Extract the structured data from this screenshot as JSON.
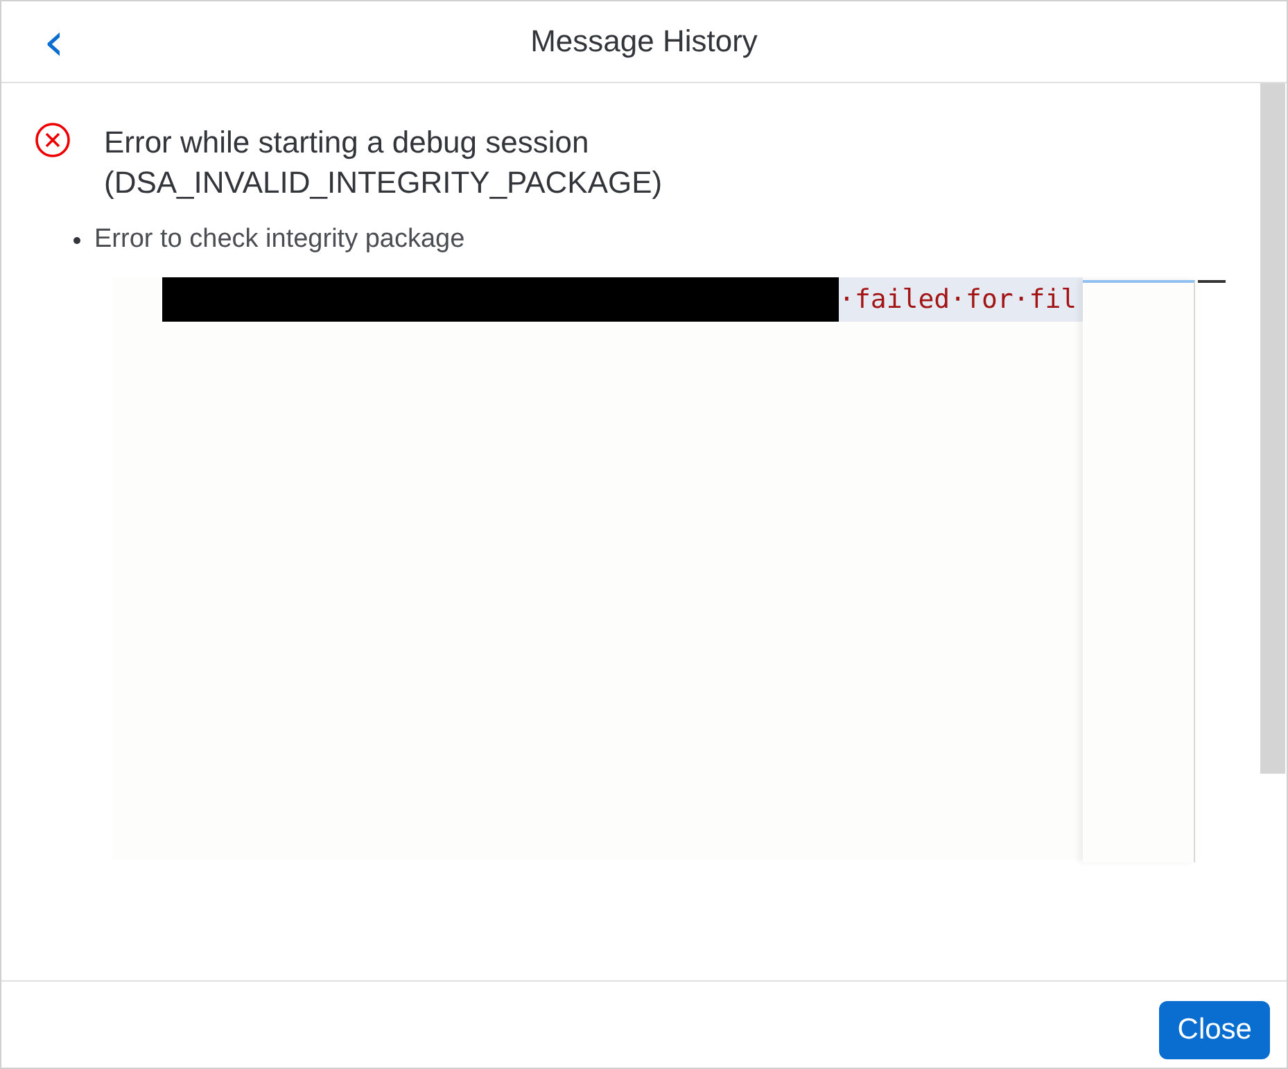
{
  "header": {
    "back_icon": "‹",
    "title": "Message History"
  },
  "messages": [
    {
      "kind": "error",
      "title": "Error while starting a debug session",
      "code": "(DSA_INVALID_INTEGRITY_PACKAGE)",
      "details": [
        "Error to check integrity package"
      ]
    }
  ],
  "embedded_screenshot": {
    "code_text": "·failed·for·fil"
  },
  "footer": {
    "buttons": [
      "Close"
    ]
  }
}
